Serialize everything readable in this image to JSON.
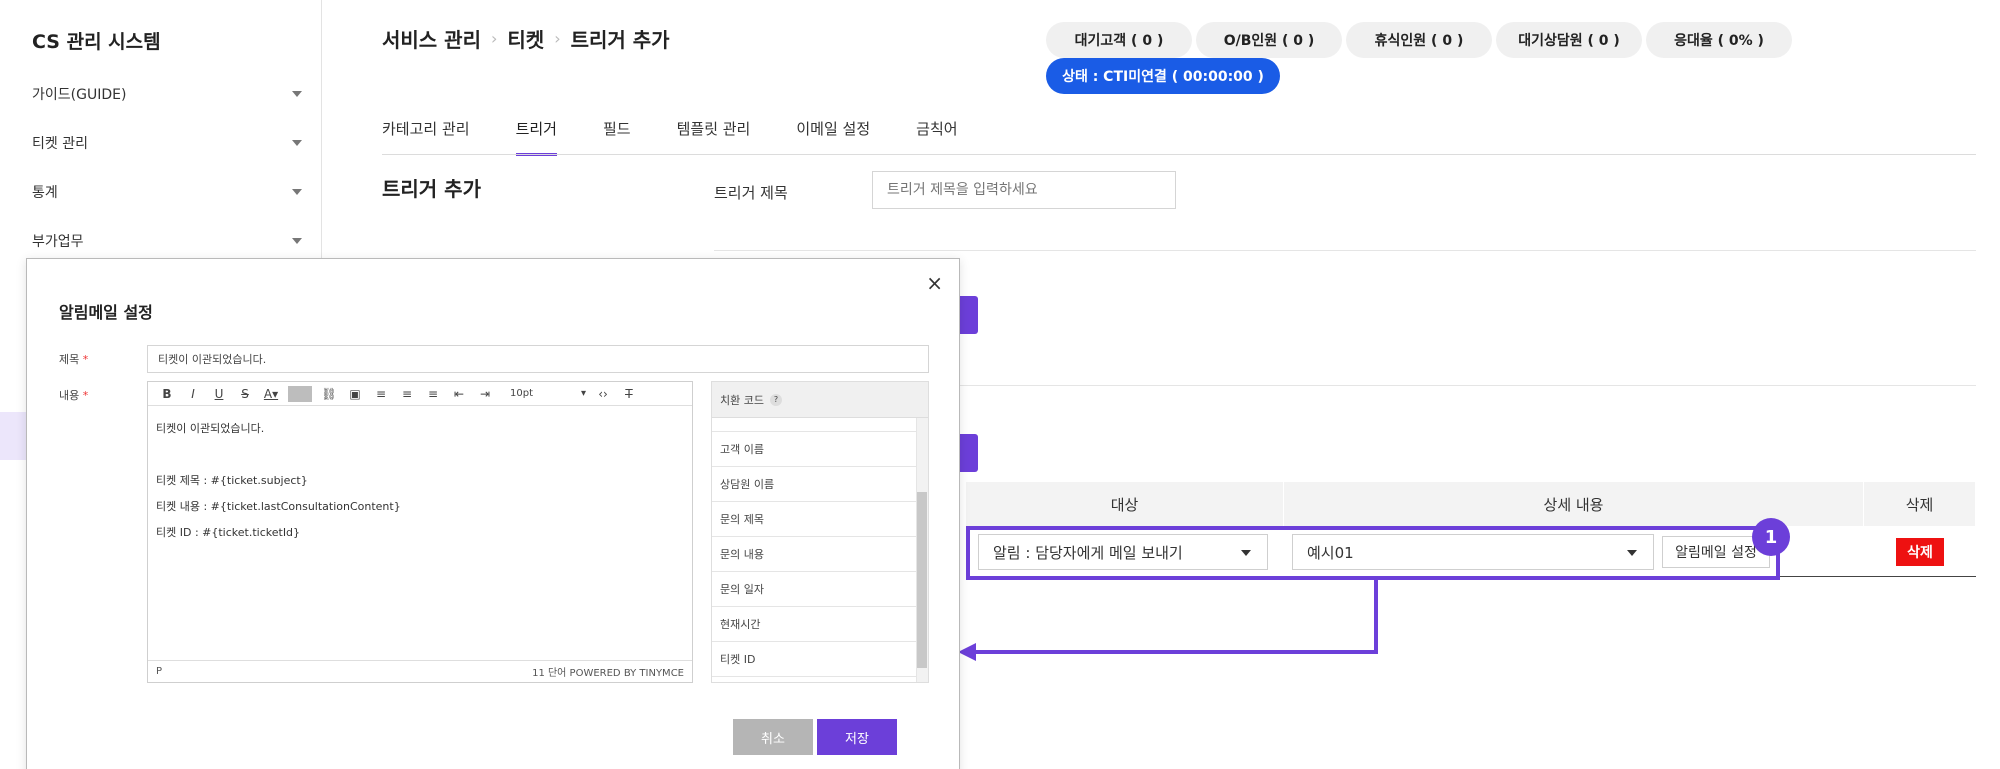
{
  "app": {
    "title": "CS 관리 시스템"
  },
  "sidebar": {
    "items": [
      {
        "label": "가이드(GUIDE)"
      },
      {
        "label": "티켓 관리"
      },
      {
        "label": "통계"
      },
      {
        "label": "부가업무"
      }
    ]
  },
  "breadcrumb": [
    "서비스 관리",
    "티켓",
    "트리거 추가"
  ],
  "status": {
    "pills": [
      "대기고객 ( 0 )",
      "O/B인원 ( 0 )",
      "휴식인원 ( 0 )",
      "대기상담원 ( 0 )",
      "응대율 ( 0% )"
    ],
    "cti": "상태 : CTI미연결 ( 00:00:00 )"
  },
  "tabs": [
    "카테고리 관리",
    "트리거",
    "필드",
    "템플릿 관리",
    "이메일 설정",
    "금칙어"
  ],
  "active_tab": "트리거",
  "form": {
    "section_title": "트리거 추가",
    "trigger_title_label": "트리거 제목",
    "trigger_title_placeholder": "트리거 제목을 입력하세요"
  },
  "action_table": {
    "headers": [
      "대상",
      "상세 내용",
      "삭제"
    ],
    "target_value": "알림 : 담당자에게 메일 보내기",
    "detail_value": "예시01",
    "mail_setting_label": "알림메일 설정",
    "delete_label": "삭제"
  },
  "annotation": {
    "badge": "1"
  },
  "modal": {
    "title": "알림메일 설정",
    "close": "×",
    "subject_label": "제목",
    "content_label": "내용",
    "subject_value": "티켓이 이관되었습니다.",
    "font_size": "10pt",
    "body_lines": [
      "티켓이 이관되었습니다.",
      "",
      "티켓 제목 : #{ticket.subject}",
      "티켓 내용 : #{ticket.lastConsultationContent}",
      "티켓 ID : #{ticket.ticketId}"
    ],
    "status_left": "P",
    "status_right": "11 단어 POWERED BY TINYMCE",
    "sub_panel_title": "치환 코드",
    "sub_items": [
      "고객 이름",
      "상담원 이름",
      "문의 제목",
      "문의 내용",
      "문의 일자",
      "현재시간",
      "티켓 ID"
    ],
    "cancel": "취소",
    "save": "저장"
  },
  "colors": {
    "accent": "#6c3fd9",
    "cti_blue": "#1a5ce6",
    "delete_red": "#ee1111"
  }
}
